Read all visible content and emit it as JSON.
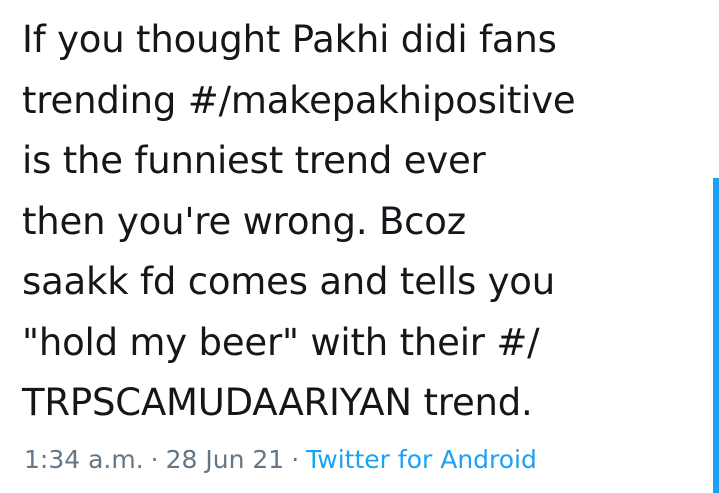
{
  "tweet": {
    "lines": [
      "If you thought Pakhi didi fans",
      "trending #/makepakhipositive",
      "is the funniest trend ever",
      "then you're wrong. Bcoz",
      "saakk fd comes and tells you",
      "\"hold my beer\" with their #/",
      "TRPSCAMUDAARIYAN trend."
    ],
    "time": "1:34 a.m.",
    "separator": "·",
    "date": "28 Jun 21",
    "source": "Twitter for Android"
  },
  "colors": {
    "text": "#14171a",
    "meta": "#657786",
    "accent": "#1da1f2"
  }
}
